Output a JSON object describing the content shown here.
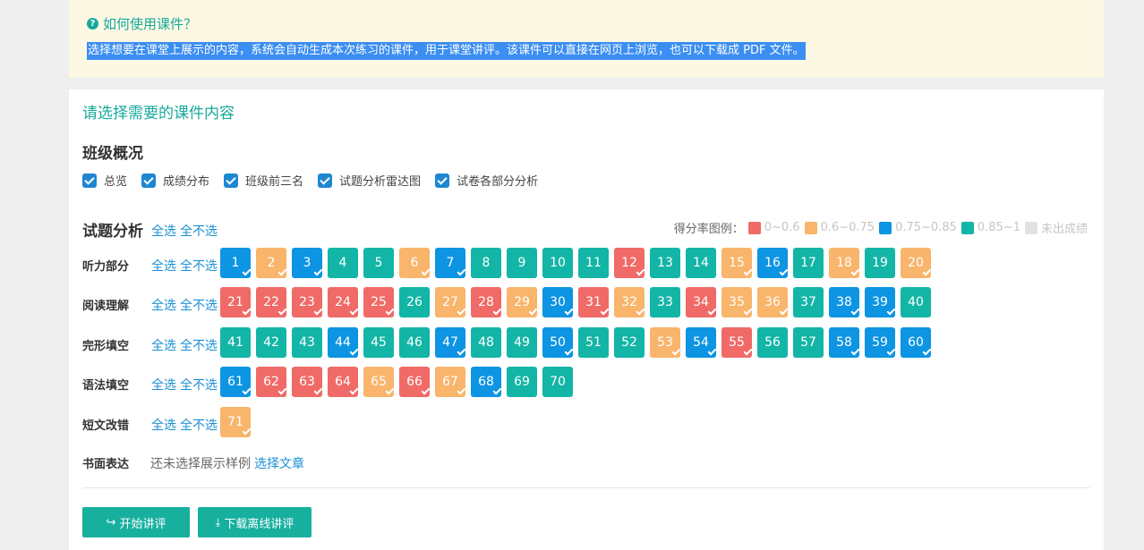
{
  "help": {
    "title": "如何使用课件？",
    "description": "选择想要在课堂上展示的内容，系统会自动生成本次练习的课件，用于课堂讲评。该课件可以直接在网页上浏览，也可以下载成 PDF 文件。"
  },
  "card": {
    "title": "请选择需要的课件内容"
  },
  "overview": {
    "title": "班级概况",
    "options": [
      "总览",
      "成绩分布",
      "班级前三名",
      "试题分析雷达图",
      "试卷各部分分析"
    ]
  },
  "analysis": {
    "title": "试题分析",
    "select_all": "全选",
    "select_none": "全不选",
    "legend_label": "得分率图例：",
    "legend": [
      {
        "label": "0~0.6",
        "color": "#f06a67"
      },
      {
        "label": "0.6~0.75",
        "color": "#f8b56b"
      },
      {
        "label": "0.75~0.85",
        "color": "#0d94e3"
      },
      {
        "label": "0.85~1",
        "color": "#13b5a6"
      },
      {
        "label": "未出成绩",
        "color": "#e2e2e2"
      }
    ],
    "sections": [
      {
        "label": "听力部分",
        "items": [
          {
            "n": "1",
            "c": "b",
            "k": true
          },
          {
            "n": "2",
            "c": "o",
            "k": true
          },
          {
            "n": "3",
            "c": "b",
            "k": true
          },
          {
            "n": "4",
            "c": "t",
            "k": false
          },
          {
            "n": "5",
            "c": "t",
            "k": false
          },
          {
            "n": "6",
            "c": "o",
            "k": true
          },
          {
            "n": "7",
            "c": "b",
            "k": true
          },
          {
            "n": "8",
            "c": "t",
            "k": false
          },
          {
            "n": "9",
            "c": "t",
            "k": false
          },
          {
            "n": "10",
            "c": "t",
            "k": false
          },
          {
            "n": "11",
            "c": "t",
            "k": false
          },
          {
            "n": "12",
            "c": "r",
            "k": true
          },
          {
            "n": "13",
            "c": "t",
            "k": false
          },
          {
            "n": "14",
            "c": "t",
            "k": false
          },
          {
            "n": "15",
            "c": "o",
            "k": true
          },
          {
            "n": "16",
            "c": "b",
            "k": true
          },
          {
            "n": "17",
            "c": "t",
            "k": false
          },
          {
            "n": "18",
            "c": "o",
            "k": true
          },
          {
            "n": "19",
            "c": "t",
            "k": false
          },
          {
            "n": "20",
            "c": "o",
            "k": true
          }
        ]
      },
      {
        "label": "阅读理解",
        "items": [
          {
            "n": "21",
            "c": "r",
            "k": true
          },
          {
            "n": "22",
            "c": "r",
            "k": true
          },
          {
            "n": "23",
            "c": "r",
            "k": true
          },
          {
            "n": "24",
            "c": "r",
            "k": true
          },
          {
            "n": "25",
            "c": "r",
            "k": true
          },
          {
            "n": "26",
            "c": "t",
            "k": false
          },
          {
            "n": "27",
            "c": "o",
            "k": true
          },
          {
            "n": "28",
            "c": "r",
            "k": true
          },
          {
            "n": "29",
            "c": "o",
            "k": true
          },
          {
            "n": "30",
            "c": "b",
            "k": true
          },
          {
            "n": "31",
            "c": "r",
            "k": true
          },
          {
            "n": "32",
            "c": "o",
            "k": true
          },
          {
            "n": "33",
            "c": "t",
            "k": false
          },
          {
            "n": "34",
            "c": "r",
            "k": true
          },
          {
            "n": "35",
            "c": "o",
            "k": true
          },
          {
            "n": "36",
            "c": "o",
            "k": true
          },
          {
            "n": "37",
            "c": "t",
            "k": false
          },
          {
            "n": "38",
            "c": "b",
            "k": true
          },
          {
            "n": "39",
            "c": "b",
            "k": true
          },
          {
            "n": "40",
            "c": "t",
            "k": false
          }
        ]
      },
      {
        "label": "完形填空",
        "items": [
          {
            "n": "41",
            "c": "t",
            "k": false
          },
          {
            "n": "42",
            "c": "t",
            "k": false
          },
          {
            "n": "43",
            "c": "t",
            "k": false
          },
          {
            "n": "44",
            "c": "b",
            "k": true
          },
          {
            "n": "45",
            "c": "t",
            "k": false
          },
          {
            "n": "46",
            "c": "t",
            "k": false
          },
          {
            "n": "47",
            "c": "b",
            "k": true
          },
          {
            "n": "48",
            "c": "t",
            "k": false
          },
          {
            "n": "49",
            "c": "t",
            "k": false
          },
          {
            "n": "50",
            "c": "b",
            "k": true
          },
          {
            "n": "51",
            "c": "t",
            "k": false
          },
          {
            "n": "52",
            "c": "t",
            "k": false
          },
          {
            "n": "53",
            "c": "o",
            "k": true
          },
          {
            "n": "54",
            "c": "b",
            "k": true
          },
          {
            "n": "55",
            "c": "r",
            "k": true
          },
          {
            "n": "56",
            "c": "t",
            "k": false
          },
          {
            "n": "57",
            "c": "t",
            "k": false
          },
          {
            "n": "58",
            "c": "b",
            "k": true
          },
          {
            "n": "59",
            "c": "b",
            "k": true
          },
          {
            "n": "60",
            "c": "b",
            "k": true
          }
        ]
      },
      {
        "label": "语法填空",
        "items": [
          {
            "n": "61",
            "c": "b",
            "k": true
          },
          {
            "n": "62",
            "c": "r",
            "k": true
          },
          {
            "n": "63",
            "c": "r",
            "k": true
          },
          {
            "n": "64",
            "c": "r",
            "k": true
          },
          {
            "n": "65",
            "c": "o",
            "k": true
          },
          {
            "n": "66",
            "c": "r",
            "k": true
          },
          {
            "n": "67",
            "c": "o",
            "k": true
          },
          {
            "n": "68",
            "c": "b",
            "k": true
          },
          {
            "n": "69",
            "c": "t",
            "k": false
          },
          {
            "n": "70",
            "c": "t",
            "k": false
          }
        ]
      },
      {
        "label": "短文改错",
        "items": [
          {
            "n": "71",
            "c": "o",
            "k": true
          }
        ]
      }
    ],
    "writing": {
      "label": "书面表达",
      "status": "还未选择展示样例",
      "link": "选择文章"
    }
  },
  "buttons": {
    "start": "开始讲评",
    "download": "下载离线讲评"
  },
  "colors": {
    "r": "#f06a67",
    "o": "#f8b56b",
    "b": "#0d94e3",
    "t": "#13b5a6"
  }
}
